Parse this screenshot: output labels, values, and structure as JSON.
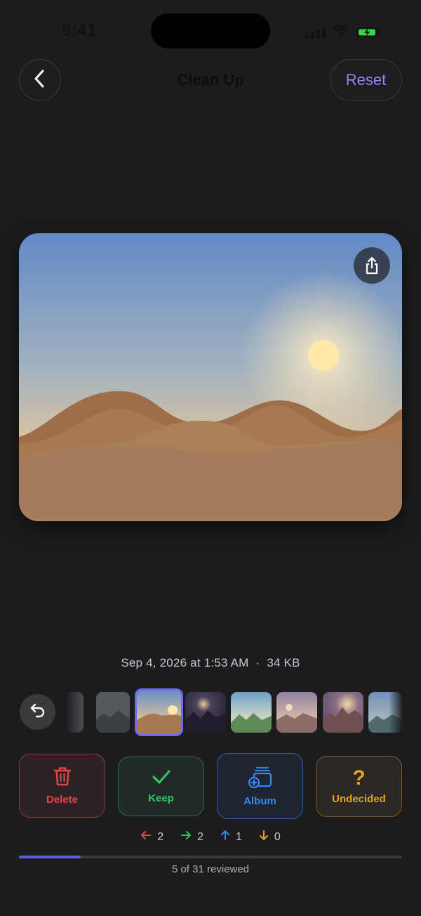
{
  "status_bar": {
    "time": "9:41",
    "icons": [
      "cellular-signal-icon",
      "wifi-icon",
      "battery-charging-icon"
    ]
  },
  "nav": {
    "title": "Clean Up",
    "back_icon": "chevron-left-icon",
    "reset_label": "Reset"
  },
  "photo": {
    "description_icon": "share-icon"
  },
  "meta": {
    "date": "Sep 4, 2026 at 1:53 AM",
    "separator": "·",
    "size": "34 KB"
  },
  "filmstrip": {
    "undo_icon": "undo-icon",
    "selected_index": 1
  },
  "actions": {
    "delete_label": "Delete",
    "keep_label": "Keep",
    "album_label": "Album",
    "undecided_label": "Undecided",
    "undecided_symbol": "?"
  },
  "counts": {
    "delete": "2",
    "keep": "2",
    "album": "1",
    "undecided": "0"
  },
  "progress": {
    "reviewed": 5,
    "total": 31,
    "label": "5 of 31 reviewed"
  },
  "colors": {
    "accent": "#6b6cf0",
    "delete": "#e04848",
    "keep": "#35c06a",
    "album": "#3b86e8",
    "undecided": "#e6a12d"
  }
}
